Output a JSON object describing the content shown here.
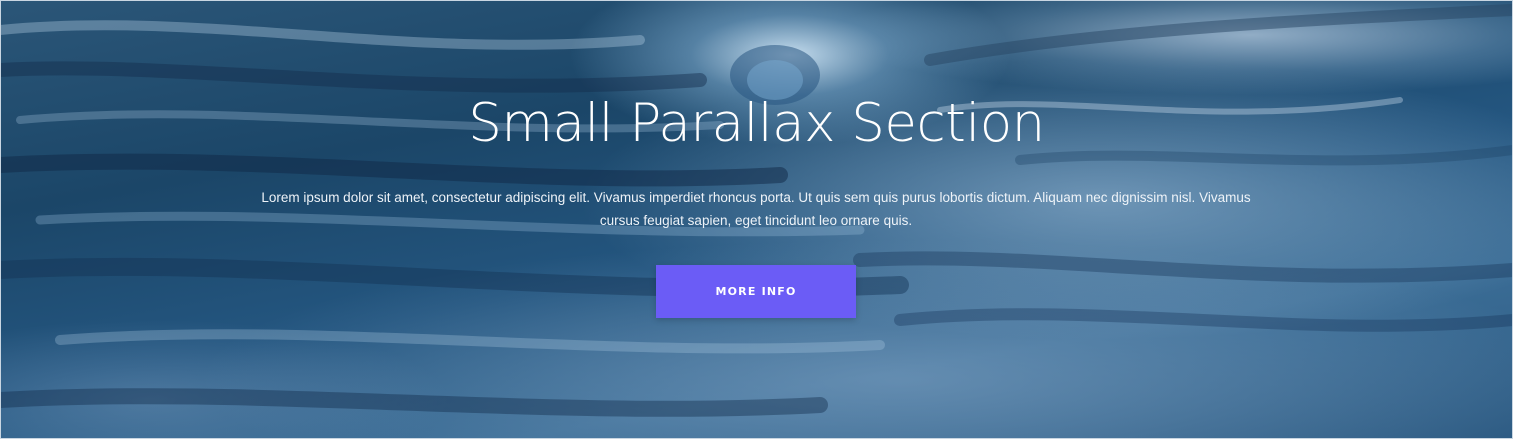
{
  "hero": {
    "title": "Small Parallax Section",
    "text": "Lorem ipsum dolor sit amet, consectetur adipiscing elit. Vivamus imperdiet rhoncus porta. Ut quis sem quis purus lobortis dictum. Aliquam nec dignissim nisl. Vivamus cursus feugiat sapien, eget tincidunt leo ornare quis.",
    "button_label": "MORE INFO",
    "background_image": "ocean-wave-image"
  },
  "colors": {
    "button": "#6b5cf6",
    "text": "#ffffff",
    "background_dark": "#1b4668",
    "background_light": "#cde4f5"
  }
}
